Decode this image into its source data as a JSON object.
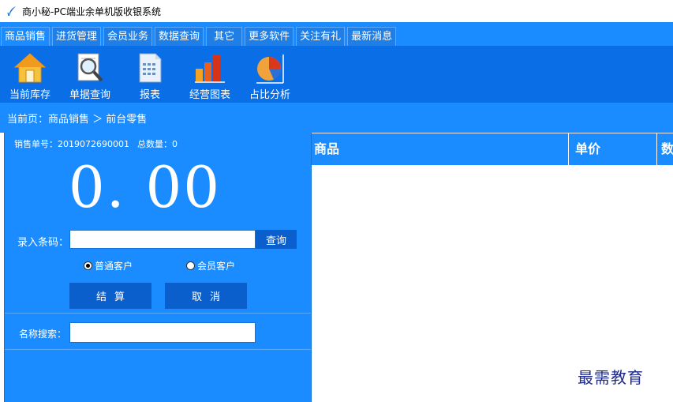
{
  "window": {
    "title": "商小秘-PC端业余单机版收银系统",
    "icon": "feather-logo-icon"
  },
  "menu": {
    "tabs": [
      {
        "label": "商品销售",
        "active": true
      },
      {
        "label": "进货管理"
      },
      {
        "label": "会员业务"
      },
      {
        "label": "数据查询"
      },
      {
        "label": "其它"
      },
      {
        "label": "更多软件"
      },
      {
        "label": "关注有礼"
      },
      {
        "label": "最新消息"
      }
    ]
  },
  "toolbar": {
    "items": [
      {
        "label": "当前库存",
        "icon": "house-icon"
      },
      {
        "label": "单据查询",
        "icon": "magnifier-document-icon"
      },
      {
        "label": "报表",
        "icon": "report-document-icon"
      },
      {
        "label": "经营图表",
        "icon": "bar-chart-icon"
      },
      {
        "label": "占比分析",
        "icon": "pie-chart-icon"
      }
    ]
  },
  "breadcrumb": {
    "text": "当前页：商品销售 ＞ 前台零售"
  },
  "sale": {
    "order_label": "销售单号：",
    "order_no": "2019072690001",
    "total_qty_label": "总数量：",
    "total_qty": "0",
    "amount": "0. 00",
    "barcode_label": "录入条码：",
    "barcode_value": "",
    "query_button": "查询",
    "radio_normal": "普通客户",
    "radio_member": "会员客户",
    "selected_customer_type": "普通客户",
    "checkout_button": "结算",
    "cancel_button": "取消",
    "name_search_label": "名称搜索：",
    "name_search_value": ""
  },
  "table": {
    "columns": [
      "商品",
      "单价",
      "数"
    ],
    "rows": []
  },
  "watermark": "最需教育",
  "colors": {
    "menu_blue": "#1a8cff",
    "toolbar_blue": "#0a6ee6",
    "button_blue": "#0b5fcc",
    "watermark": "#1e2a8a"
  }
}
